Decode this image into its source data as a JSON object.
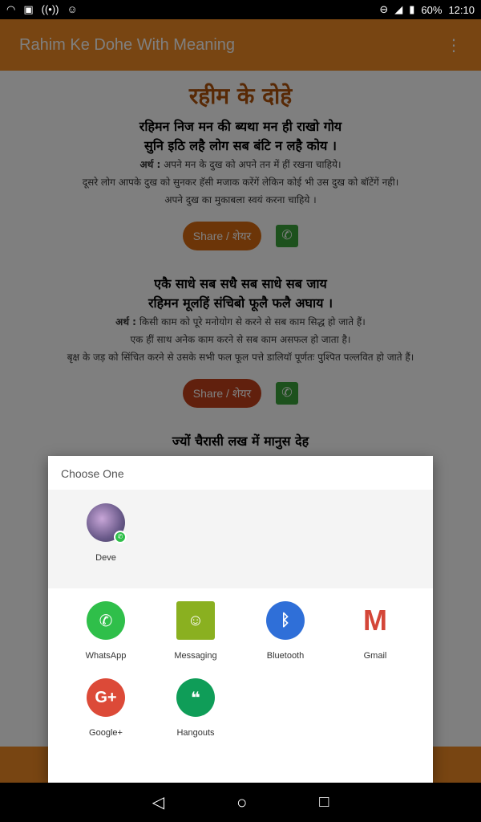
{
  "status_bar": {
    "battery": "60%",
    "time": "12:10"
  },
  "toolbar": {
    "title": "Rahim Ke Dohe With Meaning",
    "menu_icon": "more-vert-icon"
  },
  "content": {
    "heading": "रहीम के दोहे",
    "dohe": [
      {
        "line1": "रहिमन निज मन की ब्यथा मन ही राखो गोय",
        "line2": "सुनि इठि लहै लोग सब बंटि न लहै कोय ।",
        "meaning_label": "अर्थ :",
        "meaning": [
          "अपने मन के दुख को अपने तन में हीं रखना चाहिये।",
          "दूसरे लोग आपके दुख को सुनकर हॅसी मजाक करेंगें लेकिन कोई भी उस दुख को बॉटेंगें नही।",
          "अपने दुख का मुकाबला स्वयं करना चाहिये ।"
        ],
        "share": "Share / शेयर"
      },
      {
        "line1": "एकै साधे सब सधै सब साधे सब जाय",
        "line2": "रहिमन मूलहिं संचिबो फूलै फलै अघाय ।",
        "meaning_label": "अर्थ :",
        "meaning": [
          "किसी काम को पूरे मनोयोग से करने से सब काम सिद्ध हो जाते हैं।",
          "एक हीं साथ अनेक काम करने से सब काम असफल हो जाता है।",
          "बृक्ष के जड़ को सिंचित करने से उसके सभी फल फूल पत्ते डालियॉ पूर्णतः पुश्पित पल्लवित हो जाते हैं।"
        ],
        "share": "Share / शेयर"
      },
      {
        "line1": "ज्यों चैरासी लख में मानुस देह"
      }
    ]
  },
  "dialog": {
    "title": "Choose One",
    "contact": {
      "name": "Deve"
    },
    "apps": [
      {
        "label": "WhatsApp",
        "color": "#2fbf4a"
      },
      {
        "label": "Messaging",
        "color": "#8ab020"
      },
      {
        "label": "Bluetooth",
        "color": "#2f6fd8"
      },
      {
        "label": "Gmail",
        "color": "#d44638"
      },
      {
        "label": "Google+",
        "color": "#dc4a38"
      },
      {
        "label": "Hangouts",
        "color": "#0f9d58"
      }
    ]
  },
  "colors": {
    "toolbar": "#f08a24",
    "heading": "#b0520a"
  }
}
